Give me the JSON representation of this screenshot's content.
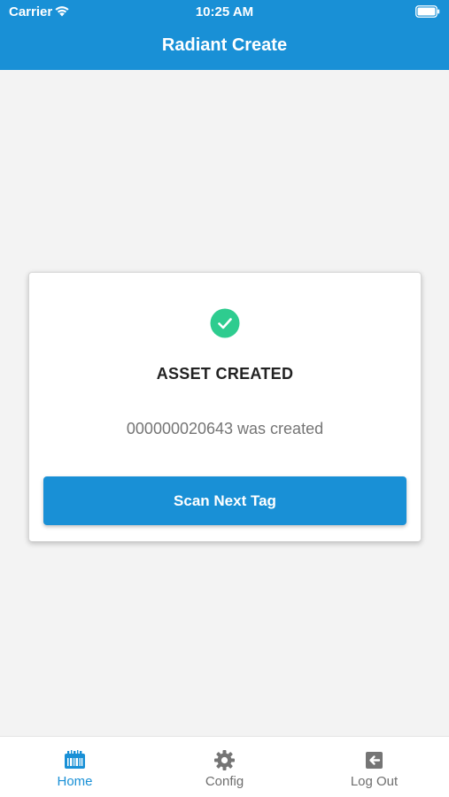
{
  "status_bar": {
    "carrier": "Carrier",
    "time": "10:25 AM"
  },
  "header": {
    "title": "Radiant Create"
  },
  "card": {
    "icon": "check-circle-icon",
    "heading": "ASSET CREATED",
    "message": "000000020643 was created",
    "button_label": "Scan Next Tag"
  },
  "tabs": [
    {
      "label": "Home",
      "icon": "barcode-scanner-icon",
      "active": true
    },
    {
      "label": "Config",
      "icon": "gear-icon",
      "active": false
    },
    {
      "label": "Log Out",
      "icon": "logout-icon",
      "active": false
    }
  ],
  "colors": {
    "primary": "#1990d6",
    "success": "#2ecc8f",
    "background": "#f3f3f3",
    "inactive_tab": "#6e6e6e"
  }
}
